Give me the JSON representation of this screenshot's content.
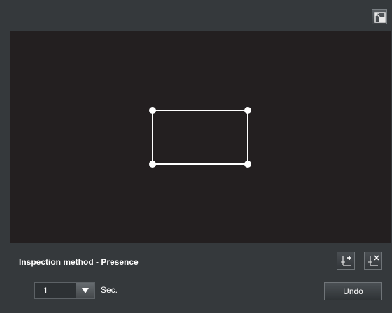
{
  "toolbar": {
    "expand_icon": "expand-icon"
  },
  "canvas": {
    "shape": "rectangle",
    "vertices": 4
  },
  "inspection": {
    "method_label": "Inspection method - Presence",
    "add_vertex_icon": "add-vertex-icon",
    "delete_vertex_icon": "delete-vertex-icon"
  },
  "duration": {
    "value": "1",
    "unit": "Sec."
  },
  "actions": {
    "undo_label": "Undo"
  },
  "colors": {
    "background": "#35393c",
    "canvas": "#231f20",
    "shape": "#ffffff"
  }
}
